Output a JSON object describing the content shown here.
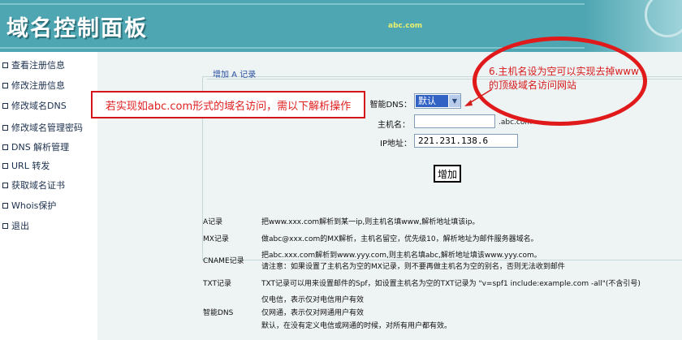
{
  "header": {
    "logo": "域名控制面板",
    "domain": "abc.com"
  },
  "sidebar": {
    "items": [
      {
        "label": "查看注册信息"
      },
      {
        "label": "修改注册信息"
      },
      {
        "label": "修改域名DNS"
      },
      {
        "label": "修改域名管理密码"
      },
      {
        "label": "DNS 解析管理"
      },
      {
        "label": "URL 转发"
      },
      {
        "label": "获取域名证书"
      },
      {
        "label": "Whois保护"
      },
      {
        "label": "退出"
      }
    ]
  },
  "panel": {
    "title": "增加 A 记录"
  },
  "form": {
    "dns_label": "智能DNS：",
    "dns_value": "默认",
    "host_label": "主机名：",
    "host_value": "",
    "host_suffix": ".abc.com",
    "ip_label": "IP地址：",
    "ip_value": "221.231.138.6",
    "submit": "增加"
  },
  "annotations": {
    "box": "若实现如abc.com形式的域名访问，需以下解析操作",
    "ellipse": "6.主机名设为空可以实现去掉www的顶级域名访问网站"
  },
  "help": [
    {
      "label": "A记录",
      "lines": [
        "把www.xxx.com解析到某一ip,则主机名填www,解析地址填该ip。"
      ]
    },
    {
      "label": "MX记录",
      "lines": [
        "做abc@xxx.com的MX解析，主机名留空，优先级10，解析地址为邮件服务器域名。"
      ]
    },
    {
      "label": "CNAME记录",
      "lines": [
        "把abc.xxx.com解析到www.yyy.com,则主机名填abc,解析地址填该www.yyy.com。",
        "请注意：如果设置了主机名为空的MX记录，则不要再做主机名为空的别名，否则无法收到邮件"
      ]
    },
    {
      "label": "TXT记录",
      "lines": [
        "TXT记录可以用来设置邮件的Spf，如设置主机名为空的TXT记录为 \"v=spf1 include:example.com -all\"(不含引号)"
      ]
    },
    {
      "label": "智能DNS",
      "lines": [
        "仅电信，表示仅对电信用户有效",
        "仅网通，表示仅对网通用户有效",
        "默认，在没有定义电信或网通的时候，对所有用户都有效。"
      ]
    }
  ]
}
